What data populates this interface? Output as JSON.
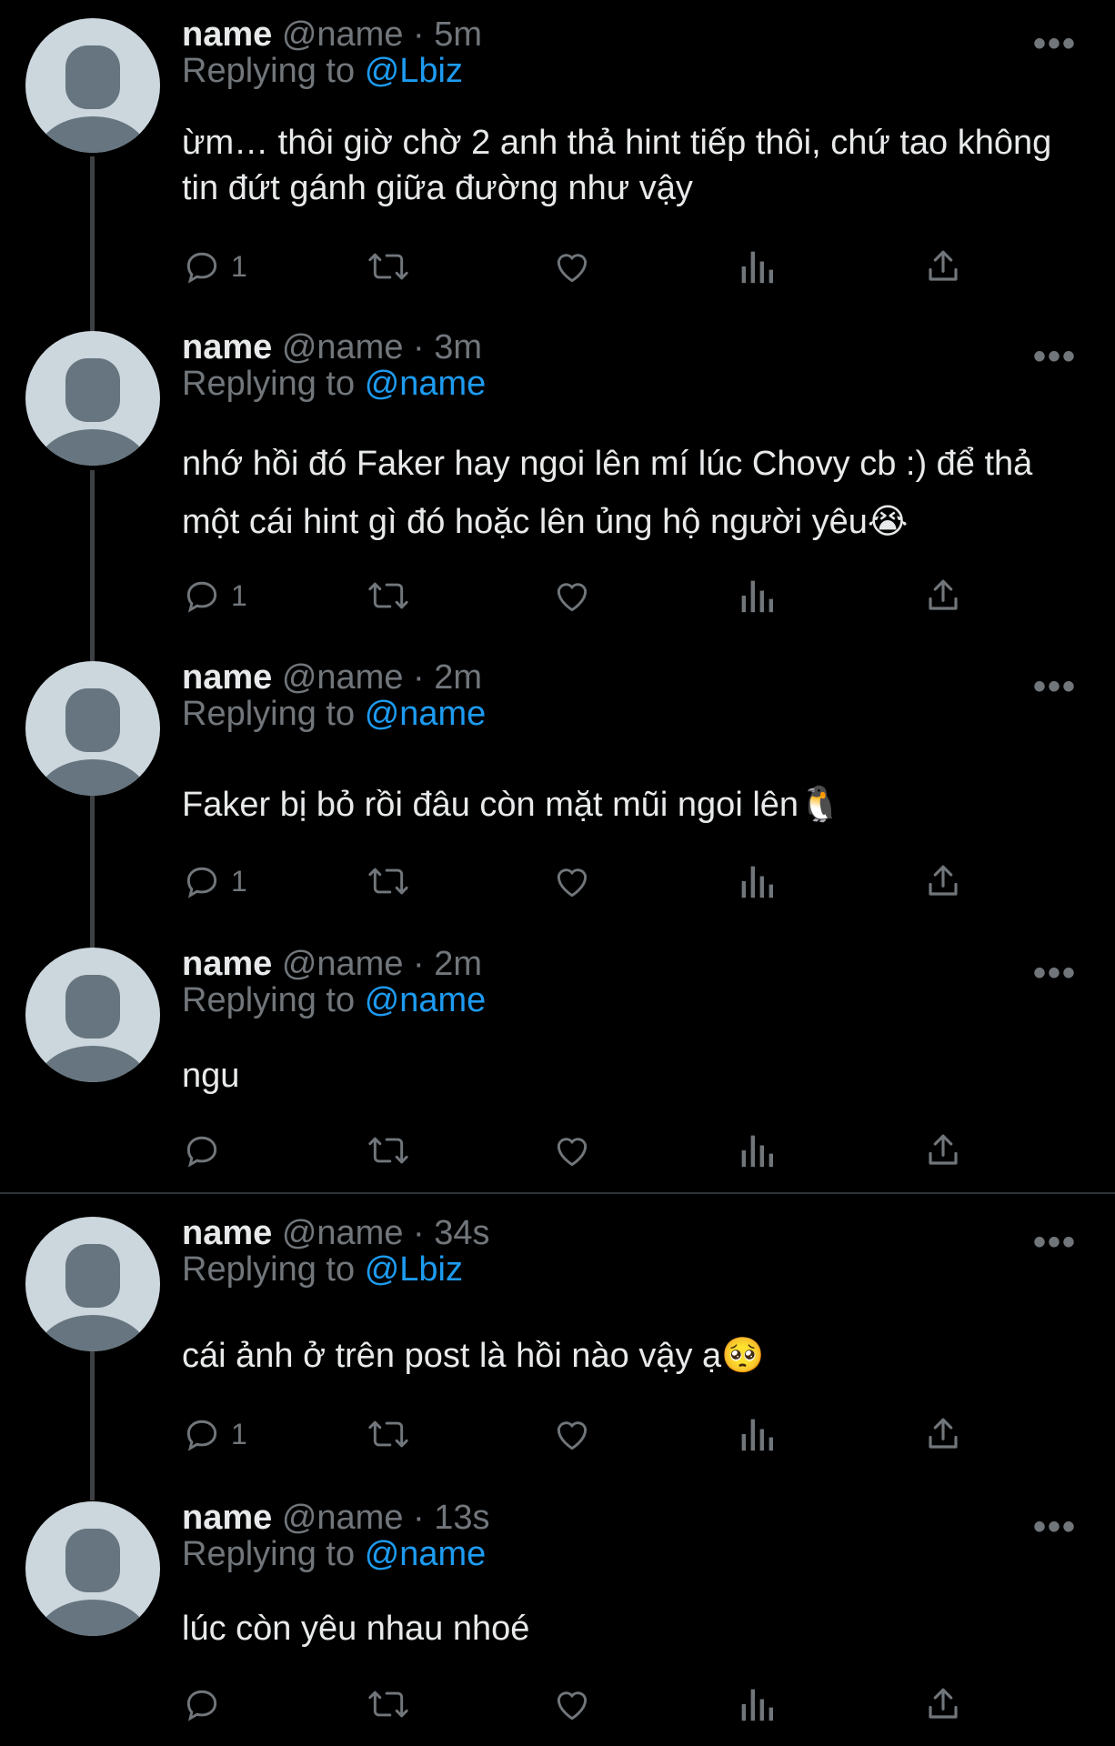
{
  "tweets": [
    {
      "name": "name",
      "handle": "@name",
      "time": "5m",
      "replying_prefix": "Replying to",
      "replying_to": "@Lbiz",
      "text": "ừm… thôi giờ chờ 2 anh thả hint tiếp thôi, chứ tao không tin đứt gánh giữa đường như vậy",
      "reply_count": "1"
    },
    {
      "name": "name",
      "handle": "@name",
      "time": "3m",
      "replying_prefix": "Replying to",
      "replying_to": "@name",
      "text": "nhớ hồi đó Faker hay ngoi lên mí lúc Chovy cb :) để thả một cái hint gì đó hoặc lên ủng hộ người yêu😭",
      "reply_count": "1"
    },
    {
      "name": "name",
      "handle": "@name",
      "time": "2m",
      "replying_prefix": "Replying to",
      "replying_to": "@name",
      "text": "Faker bị bỏ rồi đâu còn mặt mũi ngoi lên🐧",
      "reply_count": "1"
    },
    {
      "name": "name",
      "handle": "@name",
      "time": "2m",
      "replying_prefix": "Replying to",
      "replying_to": "@name",
      "text": "ngu",
      "reply_count": ""
    },
    {
      "name": "name",
      "handle": "@name",
      "time": "34s",
      "replying_prefix": "Replying to",
      "replying_to": "@Lbiz",
      "text": "cái ảnh ở trên post là hồi nào vậy ạ🥺",
      "reply_count": "1"
    },
    {
      "name": "name",
      "handle": "@name",
      "time": "13s",
      "replying_prefix": "Replying to",
      "replying_to": "@name",
      "text": "lúc còn yêu nhau nhoé",
      "reply_count": ""
    }
  ],
  "separator": "·",
  "more_label": "•••",
  "colors": {
    "background": "#000000",
    "text": "#e7e9ea",
    "muted": "#71767b",
    "link": "#1d9bf0",
    "avatar": "#ccd6dd",
    "avatar_figure": "#66757f"
  },
  "icons": [
    "reply-icon",
    "retweet-icon",
    "like-icon",
    "views-icon",
    "share-icon",
    "more-icon",
    "default-avatar-icon"
  ]
}
